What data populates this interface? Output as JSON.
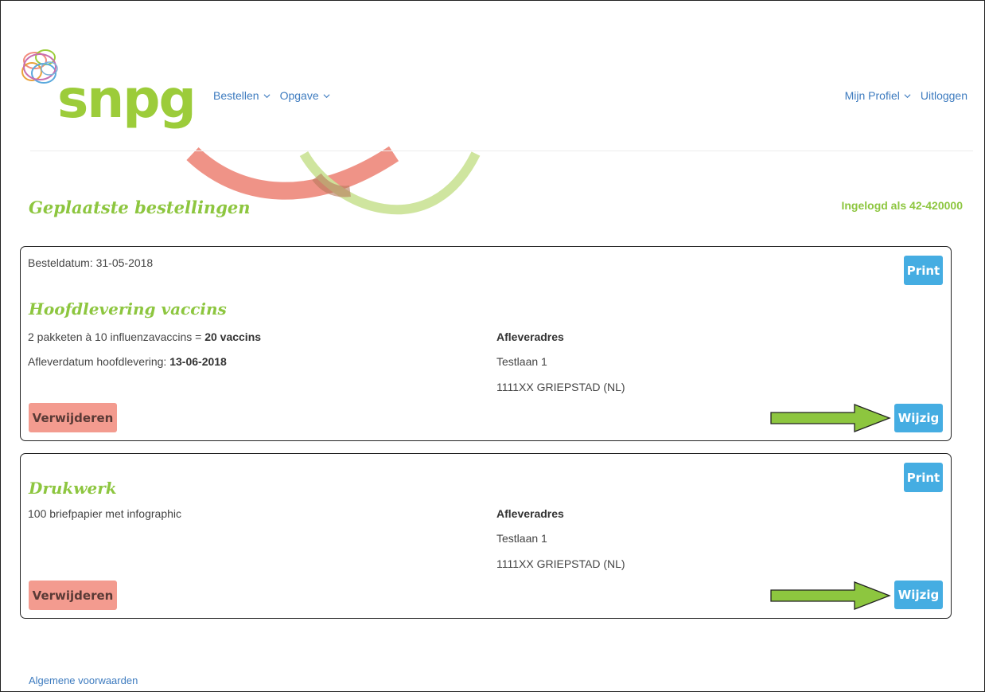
{
  "header": {
    "logo_text": "snpg",
    "nav_left": [
      {
        "label": "Bestellen"
      },
      {
        "label": "Opgave"
      }
    ],
    "nav_right": {
      "profile_label": "Mijn Profiel",
      "logout_label": "Uitloggen"
    }
  },
  "page": {
    "title": "Geplaatste bestellingen",
    "logged_in": "Ingelogd als 42-420000"
  },
  "orders": [
    {
      "order_date": "Besteldatum: 31-05-2018",
      "title": "Hoofdlevering vaccins",
      "description_prefix": "2 pakketen à 10 influenzavaccins = ",
      "description_bold": "20 vaccins",
      "delivery_prefix": "Afleverdatum hoofdlevering: ",
      "delivery_date": "13-06-2018",
      "address_heading": "Afleveradres",
      "address_line1": "Testlaan 1",
      "address_line2": "1111XX GRIEPSTAD (NL)",
      "print_label": "Print",
      "edit_label": "Wijzig",
      "delete_label": "Verwijderen"
    },
    {
      "title": "Drukwerk",
      "description": "100 briefpapier met infographic",
      "address_heading": "Afleveradres",
      "address_line1": "Testlaan 1",
      "address_line2": "1111XX GRIEPSTAD (NL)",
      "print_label": "Print",
      "edit_label": "Wijzig",
      "delete_label": "Verwijderen"
    }
  ],
  "footer": {
    "terms_label": "Algemene voorwaarden"
  },
  "colors": {
    "brand_green": "#8dc63f",
    "link_blue": "#3d7bbf",
    "button_blue": "#45ade2",
    "delete_red": "#f39b8f",
    "annotation_arrow": "#8dc63f"
  }
}
